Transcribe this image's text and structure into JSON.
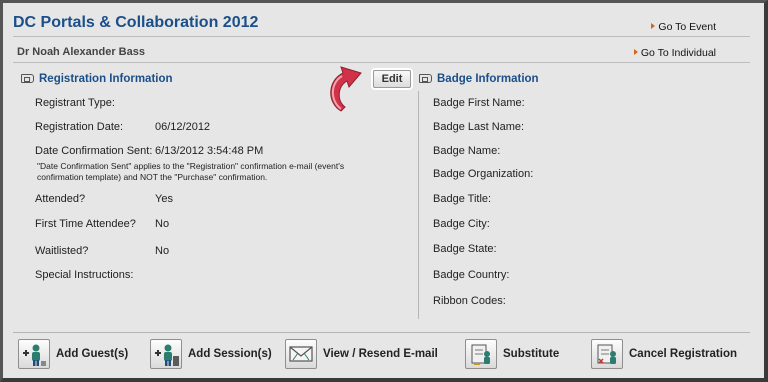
{
  "header": {
    "title": "DC Portals & Collaboration 2012",
    "goto_event": "Go To Event",
    "person_name": "Dr Noah Alexander Bass",
    "goto_individual": "Go To Individual"
  },
  "registration": {
    "section_title": "Registration Information",
    "edit_label": "Edit",
    "fields": [
      {
        "label": "Registrant Type:",
        "value": ""
      },
      {
        "label": "Registration Date:",
        "value": "06/12/2012"
      },
      {
        "label": "Date Confirmation Sent:",
        "value": "6/13/2012 3:54:48 PM"
      },
      {
        "label": "Attended?",
        "value": "Yes"
      },
      {
        "label": "First Time Attendee?",
        "value": "No"
      },
      {
        "label": "Waitlisted?",
        "value": "No"
      },
      {
        "label": "Special Instructions:",
        "value": ""
      }
    ],
    "note": "\"Date Confirmation Sent\" applies to the \"Registration\" confirmation e-mail (event's confirmation template) and NOT the \"Purchase\" confirmation."
  },
  "badge": {
    "section_title": "Badge Information",
    "fields": [
      {
        "label": "Badge First Name:"
      },
      {
        "label": "Badge Last Name:"
      },
      {
        "label": "Badge Name:"
      },
      {
        "label": "Badge Organization:"
      },
      {
        "label": "Badge Title:"
      },
      {
        "label": "Badge City:"
      },
      {
        "label": "Badge State:"
      },
      {
        "label": "Badge Country:"
      },
      {
        "label": "Ribbon Codes:"
      }
    ]
  },
  "actions": [
    {
      "label": "Add Guest(s)",
      "icon": "add-guest-icon"
    },
    {
      "label": "Add Session(s)",
      "icon": "add-session-icon"
    },
    {
      "label": "View / Resend E-mail",
      "icon": "envelope-icon"
    },
    {
      "label": "Substitute",
      "icon": "substitute-icon"
    },
    {
      "label": "Cancel Registration",
      "icon": "cancel-registration-icon"
    }
  ],
  "colors": {
    "title": "#1b4f8a",
    "link_arrow": "#d06a1a",
    "callout_arrow": "#d0324a"
  }
}
